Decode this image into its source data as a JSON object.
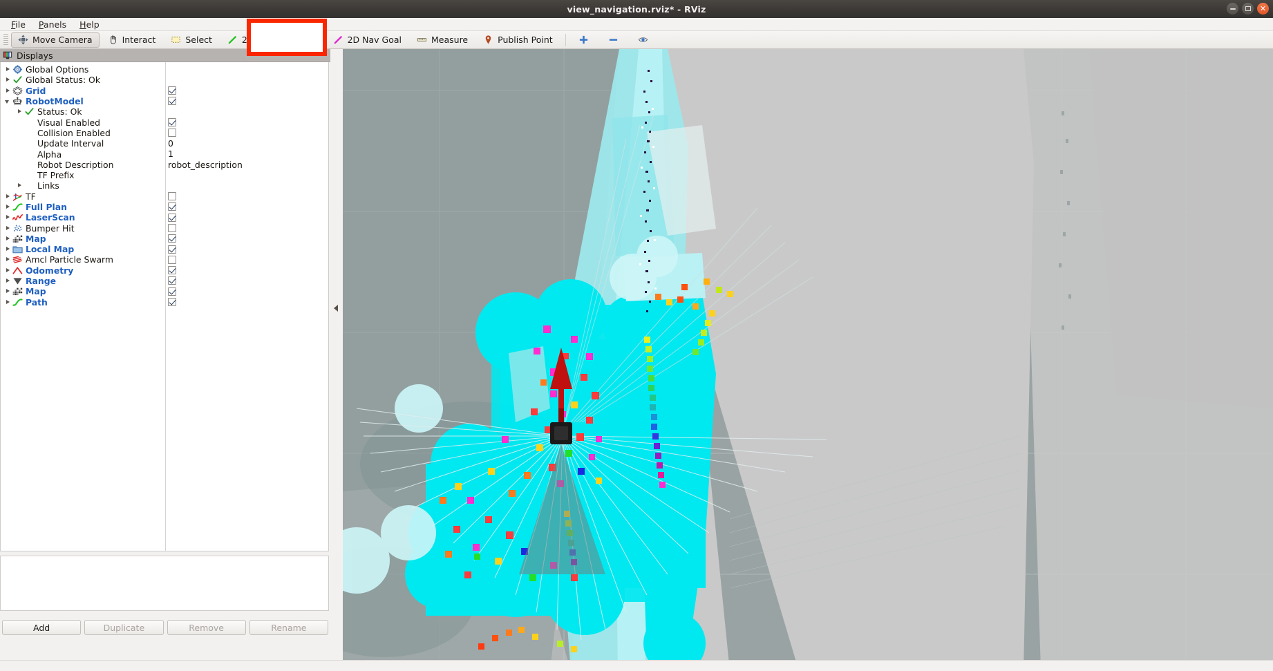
{
  "window": {
    "title": "view_navigation.rviz* - RViz",
    "controls": [
      {
        "name": "minimize",
        "glyph": "minimize-icon"
      },
      {
        "name": "maximize",
        "glyph": "maximize-icon"
      },
      {
        "name": "close",
        "glyph": "close-icon"
      }
    ]
  },
  "menubar": {
    "items": [
      {
        "label": "File",
        "mnemonic": "F"
      },
      {
        "label": "Panels",
        "mnemonic": "P"
      },
      {
        "label": "Help",
        "mnemonic": "H"
      }
    ]
  },
  "toolbar": {
    "buttons": [
      {
        "label": "Move Camera",
        "icon": "move-camera-icon",
        "active": true
      },
      {
        "label": "Interact",
        "icon": "hand-cursor-icon",
        "active": false
      },
      {
        "label": "Select",
        "icon": "selection-rect-icon",
        "active": false
      },
      {
        "label": "2D Pose Estimate",
        "icon": "green-arrow-icon",
        "active": false
      },
      {
        "label": "2D Nav Goal",
        "icon": "magenta-arrow-icon",
        "active": false,
        "highlighted": true
      },
      {
        "label": "Measure",
        "icon": "ruler-icon",
        "active": false
      },
      {
        "label": "Publish Point",
        "icon": "map-pin-icon",
        "active": false
      }
    ],
    "icon_buttons": [
      {
        "name": "focus-camera-icon",
        "label": ""
      },
      {
        "name": "remove-icon",
        "label": ""
      },
      {
        "name": "eye-visibility-icon",
        "label": ""
      }
    ],
    "highlight_color": "#fa2600"
  },
  "displays_panel": {
    "header": "Displays",
    "header_icon": "displays-icon",
    "tree": [
      {
        "indent": 0,
        "arrow": "closed",
        "icon": "gear-icon",
        "label": "Global Options",
        "bold": false,
        "control": "none"
      },
      {
        "indent": 0,
        "arrow": "closed",
        "icon": "check-icon",
        "label": "Global Status: Ok",
        "bold": false,
        "control": "none"
      },
      {
        "indent": 0,
        "arrow": "closed",
        "icon": "grid-icon",
        "label": "Grid",
        "bold": true,
        "control": "checkbox",
        "checked": true
      },
      {
        "indent": 0,
        "arrow": "open",
        "icon": "robot-icon",
        "label": "RobotModel",
        "bold": true,
        "control": "checkbox",
        "checked": true
      },
      {
        "indent": 1,
        "arrow": "closed",
        "icon": "check-icon",
        "label": "Status: Ok",
        "bold": false,
        "control": "none"
      },
      {
        "indent": 1,
        "arrow": "none",
        "icon": "none",
        "label": "Visual Enabled",
        "bold": false,
        "control": "checkbox",
        "checked": true
      },
      {
        "indent": 1,
        "arrow": "none",
        "icon": "none",
        "label": "Collision Enabled",
        "bold": false,
        "control": "checkbox",
        "checked": false
      },
      {
        "indent": 1,
        "arrow": "none",
        "icon": "none",
        "label": "Update Interval",
        "bold": false,
        "control": "value",
        "value": "0"
      },
      {
        "indent": 1,
        "arrow": "none",
        "icon": "none",
        "label": "Alpha",
        "bold": false,
        "control": "value",
        "value": "1"
      },
      {
        "indent": 1,
        "arrow": "none",
        "icon": "none",
        "label": "Robot Description",
        "bold": false,
        "control": "value",
        "value": "robot_description"
      },
      {
        "indent": 1,
        "arrow": "none",
        "icon": "none",
        "label": "TF Prefix",
        "bold": false,
        "control": "value",
        "value": ""
      },
      {
        "indent": 1,
        "arrow": "closed",
        "icon": "none",
        "label": "Links",
        "bold": false,
        "control": "none"
      },
      {
        "indent": 0,
        "arrow": "closed",
        "icon": "tf-axes-icon",
        "label": "TF",
        "bold": false,
        "control": "checkbox",
        "checked": false
      },
      {
        "indent": 0,
        "arrow": "closed",
        "icon": "path-green-icon",
        "label": "Full Plan",
        "bold": true,
        "control": "checkbox",
        "checked": true
      },
      {
        "indent": 0,
        "arrow": "closed",
        "icon": "laserscan-icon",
        "label": "LaserScan",
        "bold": true,
        "control": "checkbox",
        "checked": true
      },
      {
        "indent": 0,
        "arrow": "closed",
        "icon": "pointcloud-icon",
        "label": "Bumper Hit",
        "bold": false,
        "control": "checkbox",
        "checked": false
      },
      {
        "indent": 0,
        "arrow": "closed",
        "icon": "map-grid-icon",
        "label": "Map",
        "bold": true,
        "control": "checkbox",
        "checked": true
      },
      {
        "indent": 0,
        "arrow": "closed",
        "icon": "folder-icon",
        "label": "Local Map",
        "bold": true,
        "control": "checkbox",
        "checked": true
      },
      {
        "indent": 0,
        "arrow": "closed",
        "icon": "particles-icon",
        "label": "Amcl Particle Swarm",
        "bold": false,
        "control": "checkbox",
        "checked": false
      },
      {
        "indent": 0,
        "arrow": "closed",
        "icon": "odometry-icon",
        "label": "Odometry",
        "bold": true,
        "control": "checkbox",
        "checked": true
      },
      {
        "indent": 0,
        "arrow": "closed",
        "icon": "range-cone-icon",
        "label": "Range",
        "bold": true,
        "control": "checkbox",
        "checked": true
      },
      {
        "indent": 0,
        "arrow": "closed",
        "icon": "map-grid-icon",
        "label": "Map",
        "bold": true,
        "control": "checkbox",
        "checked": true
      },
      {
        "indent": 0,
        "arrow": "closed",
        "icon": "path-green-icon",
        "label": "Path",
        "bold": true,
        "control": "checkbox",
        "checked": true
      }
    ],
    "buttons": [
      {
        "label": "Add",
        "enabled": true
      },
      {
        "label": "Duplicate",
        "enabled": false
      },
      {
        "label": "Remove",
        "enabled": false
      },
      {
        "label": "Rename",
        "enabled": false
      }
    ]
  },
  "view3d": {
    "name": "3d-render-view",
    "background_color": "#9aa3a3",
    "map_free_color": "#cccccc",
    "costmap_inflation_color": "#00f0f0",
    "goal_arrow_color": "#cc1111",
    "robot_color": "#1a1a1a"
  }
}
